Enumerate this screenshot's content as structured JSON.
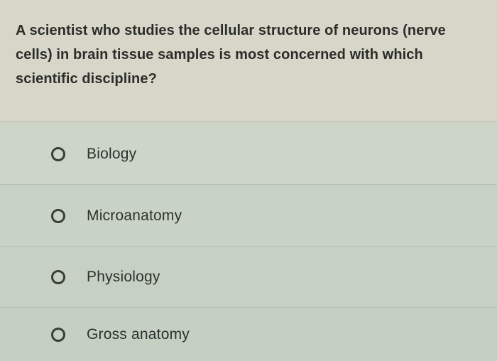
{
  "question": {
    "text": "A scientist who studies the cellular structure of neurons (nerve cells) in brain tissue samples is most concerned with which scientific discipline?"
  },
  "options": [
    {
      "label": "Biology"
    },
    {
      "label": "Microanatomy"
    },
    {
      "label": "Physiology"
    },
    {
      "label": "Gross anatomy"
    }
  ],
  "colors": {
    "question_background": "#d7d6c8",
    "option_background": "#c9d3c5",
    "text": "#2a2d2a",
    "radio_border": "#3a3d3a"
  }
}
